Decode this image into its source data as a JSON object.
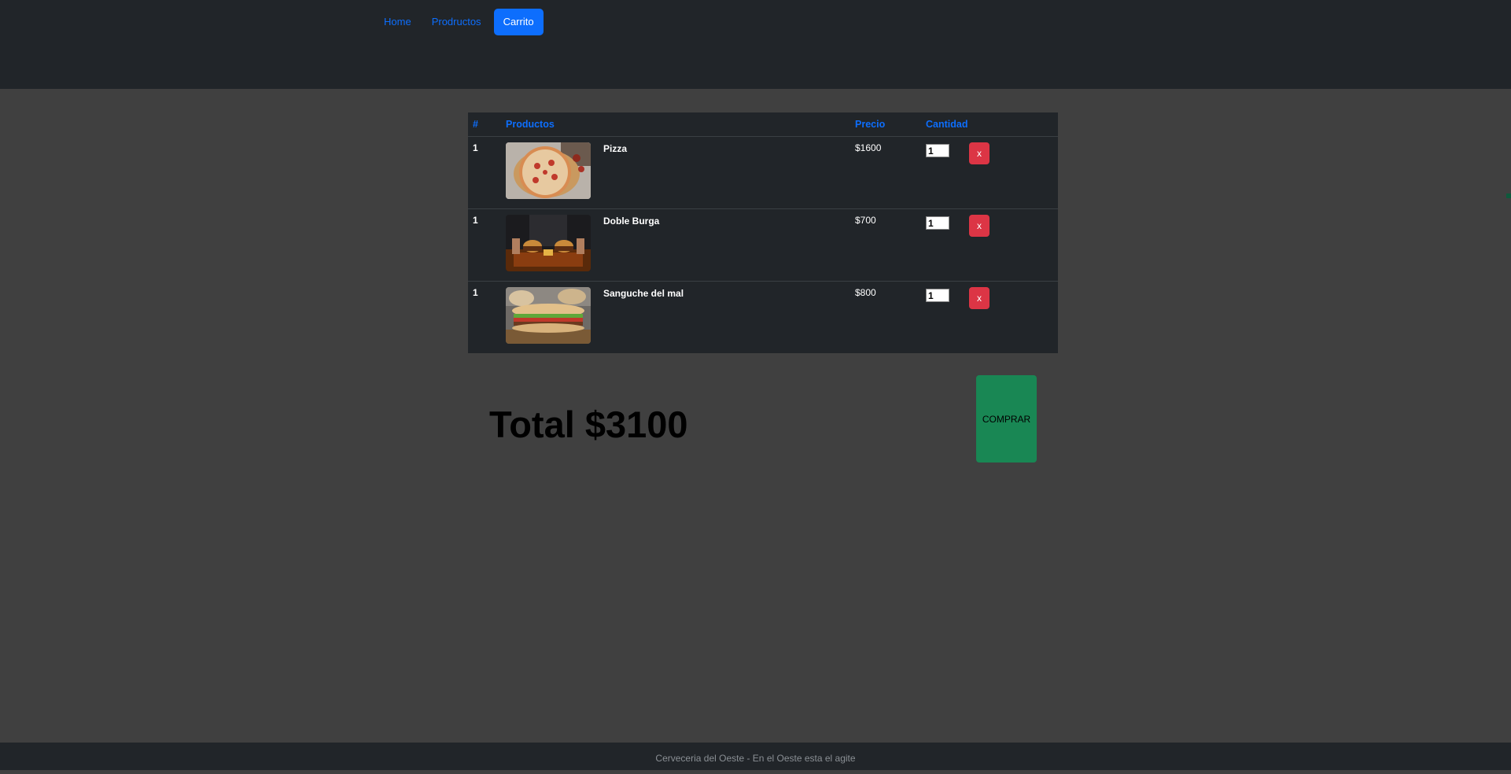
{
  "nav": {
    "home": "Home",
    "products": "Prodructos",
    "cart": "Carrito"
  },
  "table": {
    "headers": {
      "num": "#",
      "products": "Productos",
      "price": "Precio",
      "qty": "Cantidad"
    },
    "rows": [
      {
        "num": "1",
        "name": "Pizza",
        "price": "$1600",
        "qty": "1",
        "remove": "x",
        "image": "pizza-image"
      },
      {
        "num": "1",
        "name": "Doble Burga",
        "price": "$700",
        "qty": "1",
        "remove": "x",
        "image": "burger-image"
      },
      {
        "num": "1",
        "name": "Sanguche del mal",
        "price": "$800",
        "qty": "1",
        "remove": "x",
        "image": "sandwich-image"
      }
    ]
  },
  "total": "Total $3100",
  "buy_label": "COMPRAR",
  "footer": "Cerveceria del Oeste - En el Oeste esta el agite",
  "colors": {
    "navbar": "#212529",
    "page_bg": "#404040",
    "accent": "#0d6efd",
    "remove": "#dc3545",
    "buy": "#198754"
  }
}
